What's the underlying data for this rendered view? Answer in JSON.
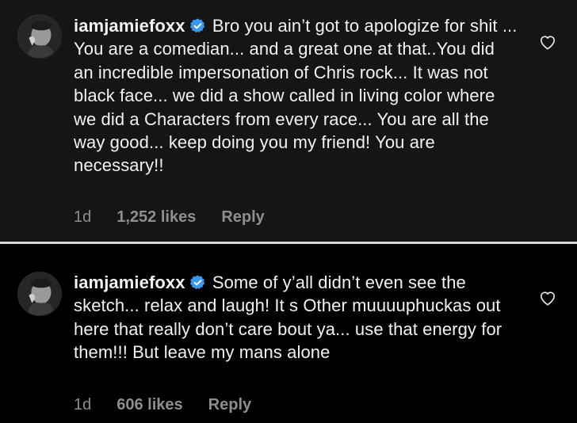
{
  "comments": [
    {
      "username": "iamjamiefoxx",
      "text": "Bro you ain’t got to apologize for shit ... You are a comedian... and a great one at that..You did an incredible impersonation of Chris rock... It was not black face... we did a show called in living color where we did a Characters from every race... You are all the way good... keep doing you my friend! You are necessary!!",
      "time": "1d",
      "likes": "1,252 likes",
      "reply": "Reply"
    },
    {
      "username": "iamjamiefoxx",
      "text": "Some of y’all didn’t even see the sketch... relax and laugh! It s Other muuuuphuckas out here that really don’t care bout ya... use that energy for them!!! But leave my mans alone",
      "time": "1d",
      "likes": "606 likes",
      "reply": "Reply"
    }
  ],
  "icons": {
    "verified": "verified-badge-icon",
    "like": "heart-outline-icon"
  },
  "colors": {
    "panel_top_bg": "#151515",
    "panel_bottom_bg": "#000000",
    "divider": "#d8d8d8",
    "text": "#f2f2f2",
    "meta_text": "#8e8e8e",
    "verified_blue": "#3897f0"
  }
}
